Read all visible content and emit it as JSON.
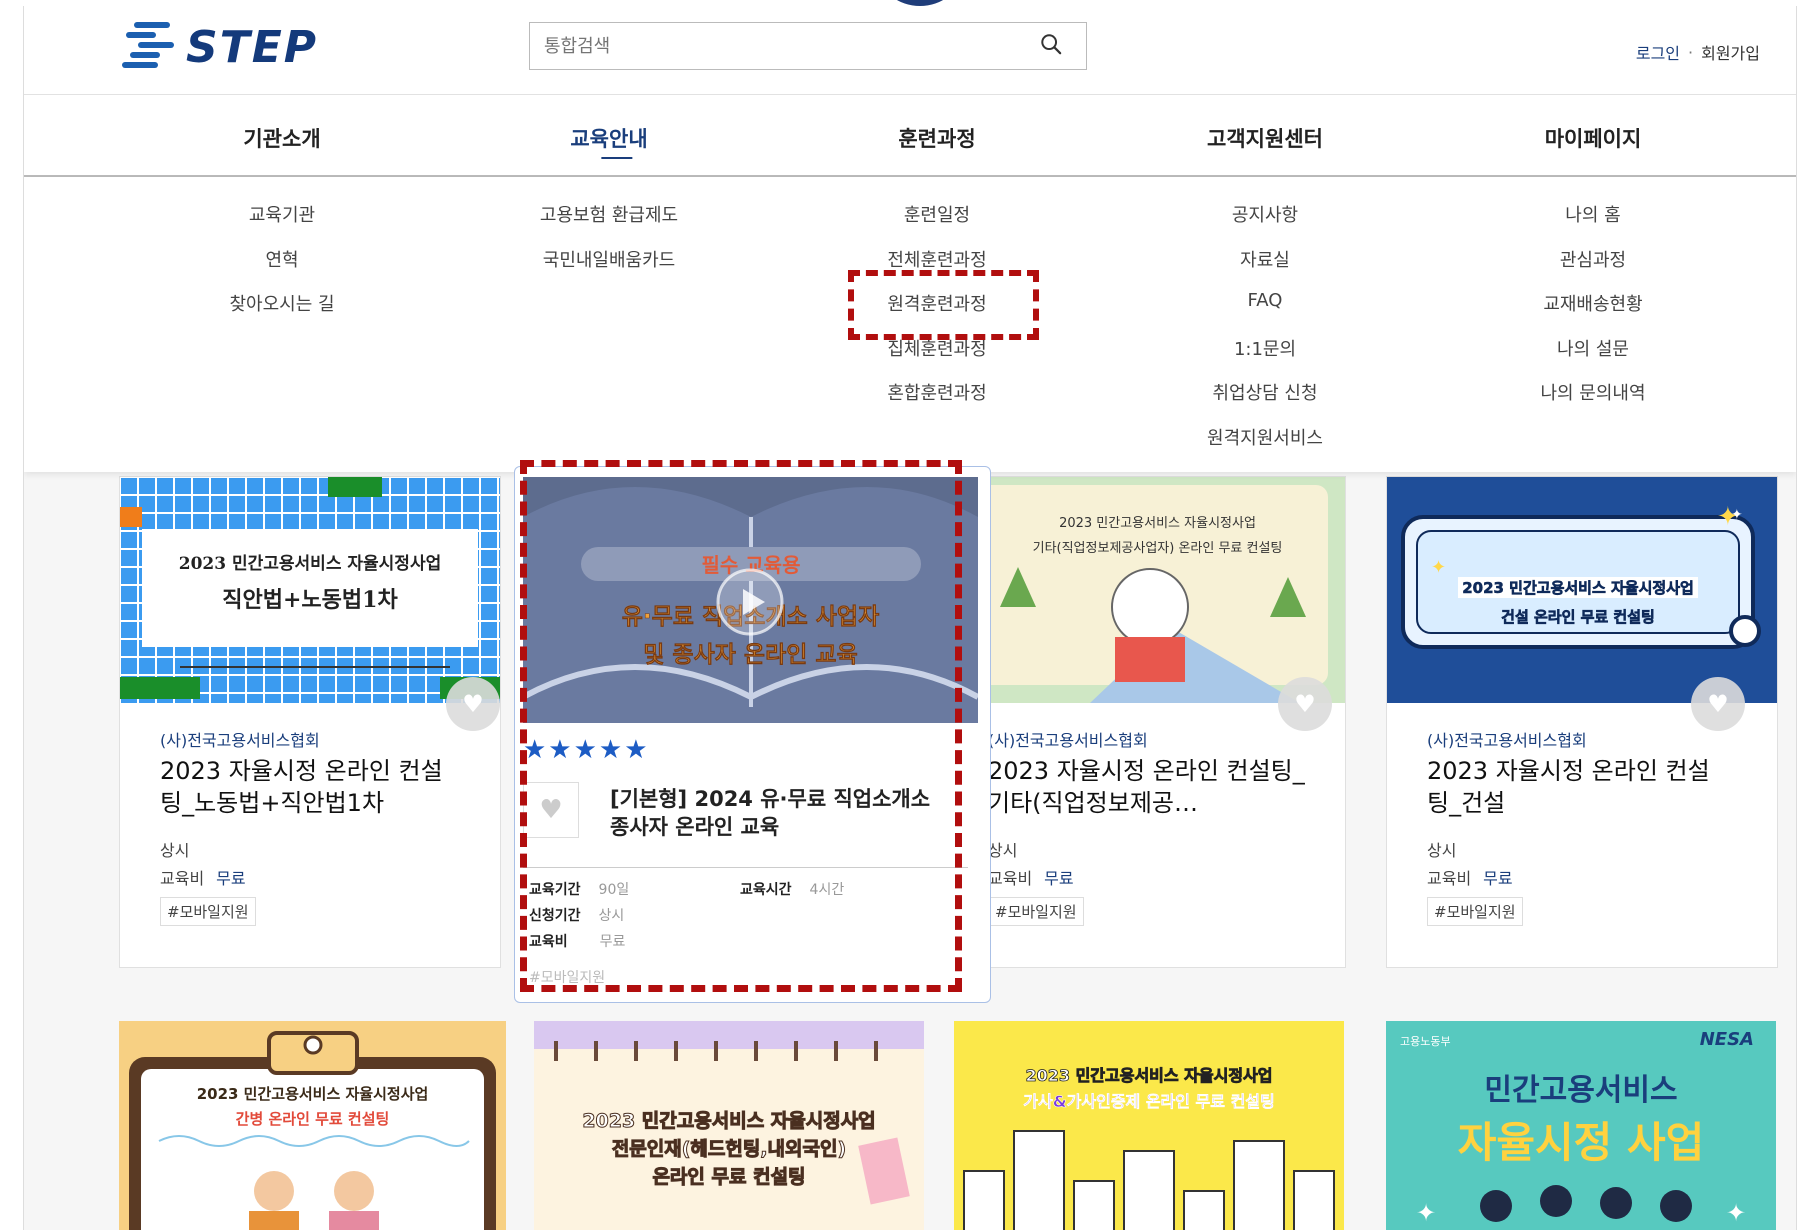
{
  "header": {
    "logo_text": "STEP",
    "search_placeholder": "통합검색",
    "login": "로그인",
    "separator": "·",
    "signup": "회원가입"
  },
  "gnb": [
    {
      "label": "기관소개"
    },
    {
      "label": "교육안내",
      "active": true
    },
    {
      "label": "훈련과정"
    },
    {
      "label": "고객지원센터"
    },
    {
      "label": "마이페이지"
    }
  ],
  "mega_menu": {
    "col1": [
      "교육기관",
      "연혁",
      "찾아오시는 길"
    ],
    "col2": [
      "고용보험 환급제도",
      "국민내일배움카드"
    ],
    "col3": [
      "훈련일정",
      "전체훈련과정",
      "원격훈련과정",
      "집체훈련과정",
      "혼합훈련과정"
    ],
    "col4": [
      "공지사항",
      "자료실",
      "FAQ",
      "1:1문의",
      "취업상담 신청",
      "원격지원서비스"
    ],
    "col5": [
      "나의 홈",
      "관심과정",
      "교재배송현황",
      "나의 설문",
      "나의 문의내역"
    ]
  },
  "cards": [
    {
      "thumb_line1": "2023 민간고용서비스 자율시정사업",
      "thumb_line2": "직안법+노동법1차",
      "org": "(사)전국고용서비스협회",
      "title": "2023 자율시정 온라인 컨설팅_노동법+직안법1차",
      "period": "상시",
      "fee_label": "교육비",
      "fee": "무료",
      "tag": "#모바일지원"
    },
    {
      "thumb_line1": "2023 민간고용서비스 자율시정사업",
      "thumb_line2": "기타(직업정보제공사업자) 온라인 무료 컨설팅",
      "org": "(사)전국고용서비스협회",
      "title": "2023 자율시정 온라인 컨설팅_기타(직업정보제공…",
      "period": "상시",
      "fee_label": "교육비",
      "fee": "무료",
      "tag": "#모바일지원"
    },
    {
      "thumb_line1": "2023 민간고용서비스 자율시정사업",
      "thumb_line2": "건설 온라인 무료 컨설팅",
      "org": "(사)전국고용서비스협회",
      "title": "2023 자율시정 온라인 컨설팅_건설",
      "period": "상시",
      "fee_label": "교육비",
      "fee": "무료",
      "tag": "#모바일지원"
    }
  ],
  "featured": {
    "thumb_badge": "필수 교육용",
    "thumb_line1": "유·무료 직업소개소 사업자",
    "thumb_line2": "및 종사자 온라인 교육",
    "stars": "★★★★★",
    "title": "[기본형] 2024 유·무료 직업소개소 종사자 온라인 교육",
    "period_label": "교육기간",
    "period": "90일",
    "hours_label": "교육시간",
    "hours": "4시간",
    "apply_label": "신청기간",
    "apply": "상시",
    "fee_label": "교육비",
    "fee": "무료",
    "tag": "#모바일지원"
  },
  "bottom_cards": [
    {
      "line1": "2023 민간고용서비스 자율시정사업",
      "line2": "간병 온라인 무료 컨설팅"
    },
    {
      "line1": "2023 민간고용서비스 자율시정사업",
      "line2": "전문인재(헤드헌팅,내외국인)",
      "line3": "온라인 무료 컨설팅"
    },
    {
      "line1": "2023 민간고용서비스 자율시정사업",
      "line2": "가사&가사인증제 온라인 무료 컨설팅"
    },
    {
      "logo_left": "고용노동부",
      "logo_right": "NESA",
      "line1": "민간고용서비스",
      "line2": "자율시정 사업"
    }
  ],
  "colors": {
    "brand": "#1a3e7c",
    "highlight": "#b10e0e",
    "star": "#1d5cc4"
  }
}
